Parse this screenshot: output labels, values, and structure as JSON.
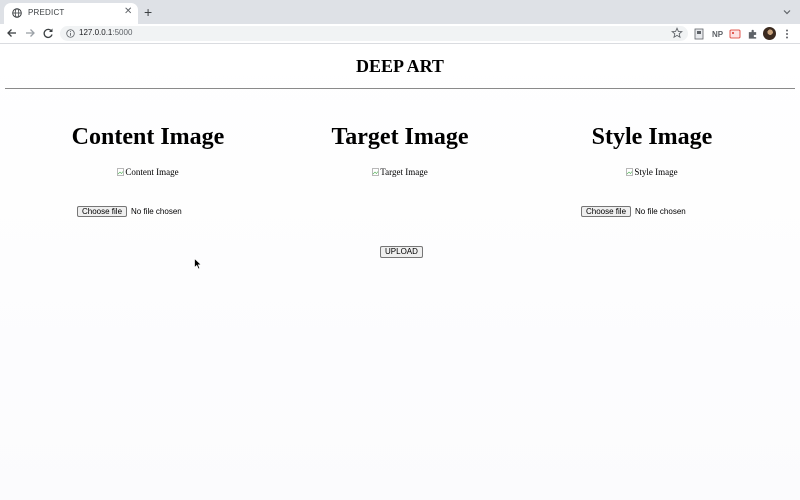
{
  "browser": {
    "tab_title": "PREDICT",
    "tab_close": "✕",
    "new_tab": "+",
    "url_host": "127.0.0.1",
    "url_port": ":5000",
    "extension_np": "NP"
  },
  "page": {
    "title": "DEEP ART",
    "columns": [
      {
        "heading": "Content Image",
        "img_alt": "Content Image"
      },
      {
        "heading": "Target Image",
        "img_alt": "Target Image"
      },
      {
        "heading": "Style Image",
        "img_alt": "Style Image"
      }
    ],
    "file_inputs": [
      {
        "button_label": "Choose file",
        "status": "No file chosen"
      },
      {
        "button_label": "Choose file",
        "status": "No file chosen"
      }
    ],
    "upload_label": "UPLOAD"
  }
}
